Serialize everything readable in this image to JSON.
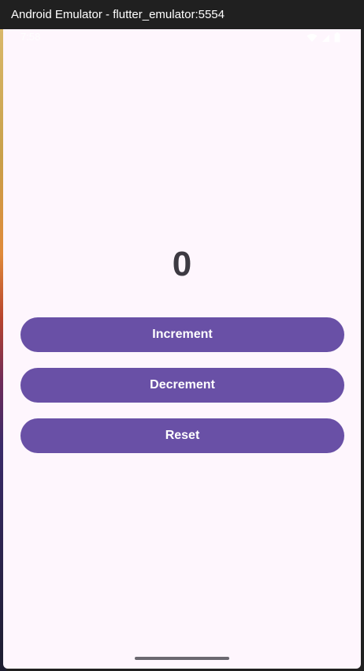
{
  "window": {
    "title": "Android Emulator - flutter_emulator:5554"
  },
  "statusbar": {
    "time": "7:58",
    "icons": [
      "wifi-icon",
      "signal-icon",
      "battery-icon"
    ]
  },
  "app": {
    "counter_value": "0",
    "buttons": {
      "increment": "Increment",
      "decrement": "Decrement",
      "reset": "Reset"
    }
  },
  "colors": {
    "background": "#fef6fd",
    "button": "#6950a6",
    "button_text": "#ffffff",
    "counter_text": "#3d3a42",
    "titlebar": "#202020"
  }
}
